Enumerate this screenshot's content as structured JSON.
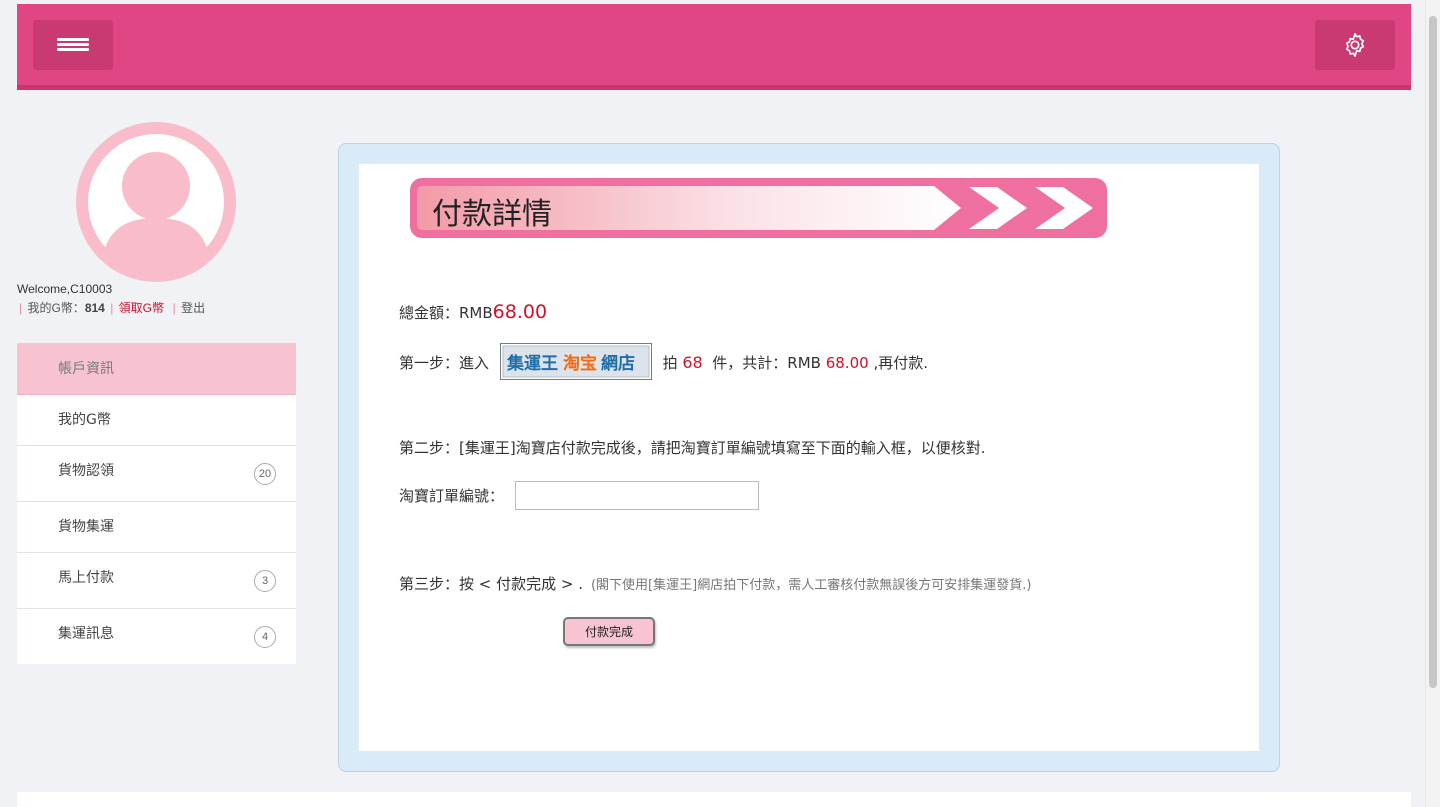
{
  "header": {
    "menu_icon": "hamburger-menu-icon",
    "settings_icon": "gear-icon",
    "color": "#e04683"
  },
  "user": {
    "welcome": "Welcome,C10003",
    "g_coin_label": "我的G幣：",
    "g_coin_value": "814",
    "claim_link": "領取G幣",
    "logout_link": "登出"
  },
  "sidebar": {
    "items": [
      {
        "label": "帳戶資訊",
        "badge": ""
      },
      {
        "label": "我的G幣",
        "badge": ""
      },
      {
        "label": "貨物認領",
        "badge": "20"
      },
      {
        "label": "貨物集運",
        "badge": ""
      },
      {
        "label": "馬上付款",
        "badge": "3"
      },
      {
        "label": "集運訊息",
        "badge": "4"
      }
    ]
  },
  "main": {
    "title": "付款詳情",
    "total_label": "總金額：RMB",
    "total_value": "68.00",
    "step1_prefix": "第一步：進入",
    "shop_logo_text": "集運王淘宝網店",
    "step1_mid": "拍",
    "quantity": "68",
    "step1_unit": "件，共計：RMB",
    "step1_amount": "68.00",
    "step1_suffix": ",再付款.",
    "step2_text": "第二步：[集運王]淘寶店付款完成後，請把淘寶訂單編號填寫至下面的輸入框，以便核對.",
    "order_label": "淘寶訂單編號：",
    "order_value": "",
    "step3_text": "第三步：按 < 付款完成 > .",
    "step3_note": "(閣下使用[集運王]網店拍下付款，需人工審核付款無誤後方可安排集運發貨.)",
    "pay_button": "付款完成"
  }
}
